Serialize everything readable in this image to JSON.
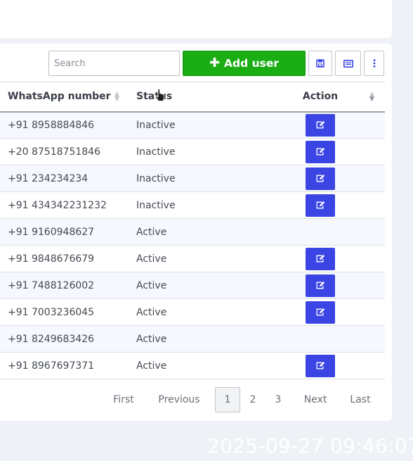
{
  "toolbar": {
    "search_placeholder": "Search",
    "search_value": "",
    "add_user_label": "Add user",
    "save_icon": "save-icon",
    "columns_icon": "columns-icon",
    "more_icon": "kebab-menu-icon"
  },
  "table": {
    "headers": {
      "whatsapp": "WhatsApp number",
      "status": "Status",
      "action": "Action"
    },
    "rows": [
      {
        "number": "+91 8958884846",
        "status": "Inactive",
        "editable": true
      },
      {
        "number": "+20 87518751846",
        "status": "Inactive",
        "editable": true
      },
      {
        "number": "+91 234234234",
        "status": "Inactive",
        "editable": true
      },
      {
        "number": "+91 434342231232",
        "status": "Inactive",
        "editable": true
      },
      {
        "number": "+91 9160948627",
        "status": "Active",
        "editable": false
      },
      {
        "number": "+91 9848676679",
        "status": "Active",
        "editable": true
      },
      {
        "number": "+91 7488126002",
        "status": "Active",
        "editable": true
      },
      {
        "number": "+91 7003236045",
        "status": "Active",
        "editable": true
      },
      {
        "number": "+91 8249683426",
        "status": "Active",
        "editable": false
      },
      {
        "number": "+91 8967697371",
        "status": "Active",
        "editable": true
      }
    ]
  },
  "pagination": {
    "first": "First",
    "previous": "Previous",
    "pages": [
      "1",
      "2",
      "3"
    ],
    "current_page": "1",
    "next": "Next",
    "last": "Last"
  },
  "timestamp": "2025-09-27 09:46:07",
  "colors": {
    "add_button": "#1aad14",
    "edit_button": "#3b45e4",
    "stripe": "#f5f8fd"
  }
}
